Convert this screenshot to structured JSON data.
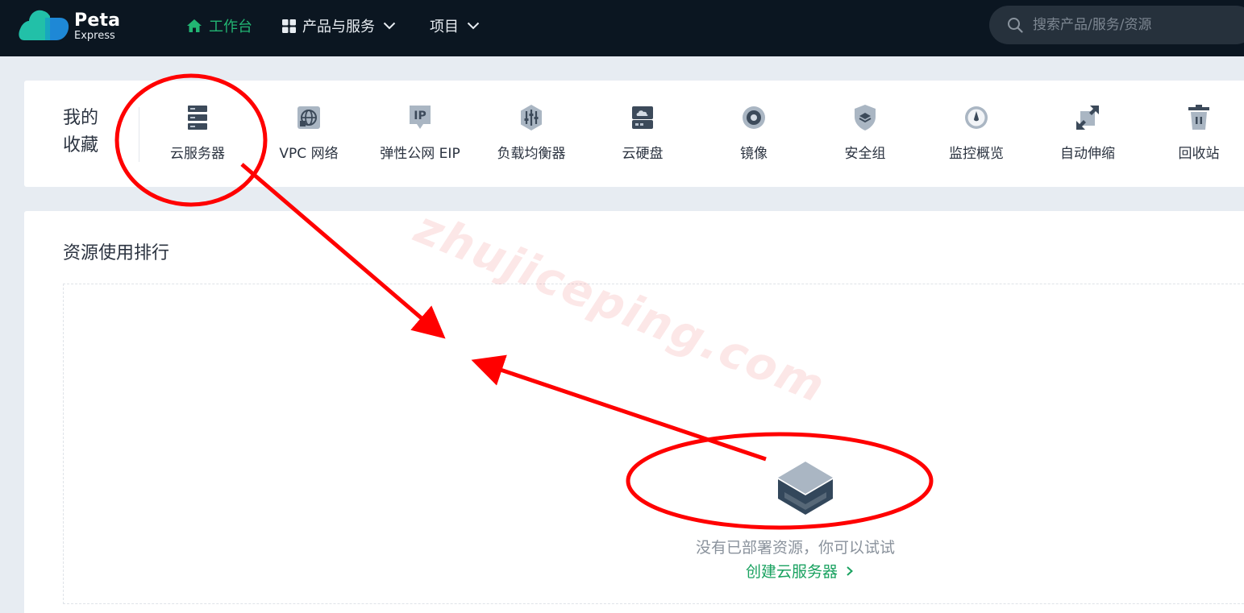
{
  "brand": {
    "line1": "Peta",
    "line2": "Express"
  },
  "nav": {
    "workbench": "工作台",
    "products": "产品与服务",
    "projects": "项目"
  },
  "search": {
    "placeholder": "搜索产品/服务/资源"
  },
  "favorites": {
    "title": "我的收藏",
    "items": [
      {
        "label": "云服务器",
        "icon": "server-icon"
      },
      {
        "label": "VPC 网络",
        "icon": "globe-network-icon"
      },
      {
        "label": "弹性公网 EIP",
        "icon": "ip-tag-icon"
      },
      {
        "label": "负载均衡器",
        "icon": "load-balancer-icon"
      },
      {
        "label": "云硬盘",
        "icon": "cloud-disk-icon"
      },
      {
        "label": "镜像",
        "icon": "image-disc-icon"
      },
      {
        "label": "安全组",
        "icon": "shield-icon"
      },
      {
        "label": "监控概览",
        "icon": "gauge-icon"
      },
      {
        "label": "自动伸缩",
        "icon": "auto-scale-icon"
      },
      {
        "label": "回收站",
        "icon": "trash-icon"
      }
    ]
  },
  "ranking": {
    "title": "资源使用排行",
    "empty_text": "没有已部署资源，你可以试试",
    "create_link": "创建云服务器"
  },
  "watermark": "zhujiceping.com",
  "colors": {
    "topbar": "#0b1621",
    "accent": "#22b573",
    "link": "#1aa260",
    "annotation": "#ff0000"
  }
}
